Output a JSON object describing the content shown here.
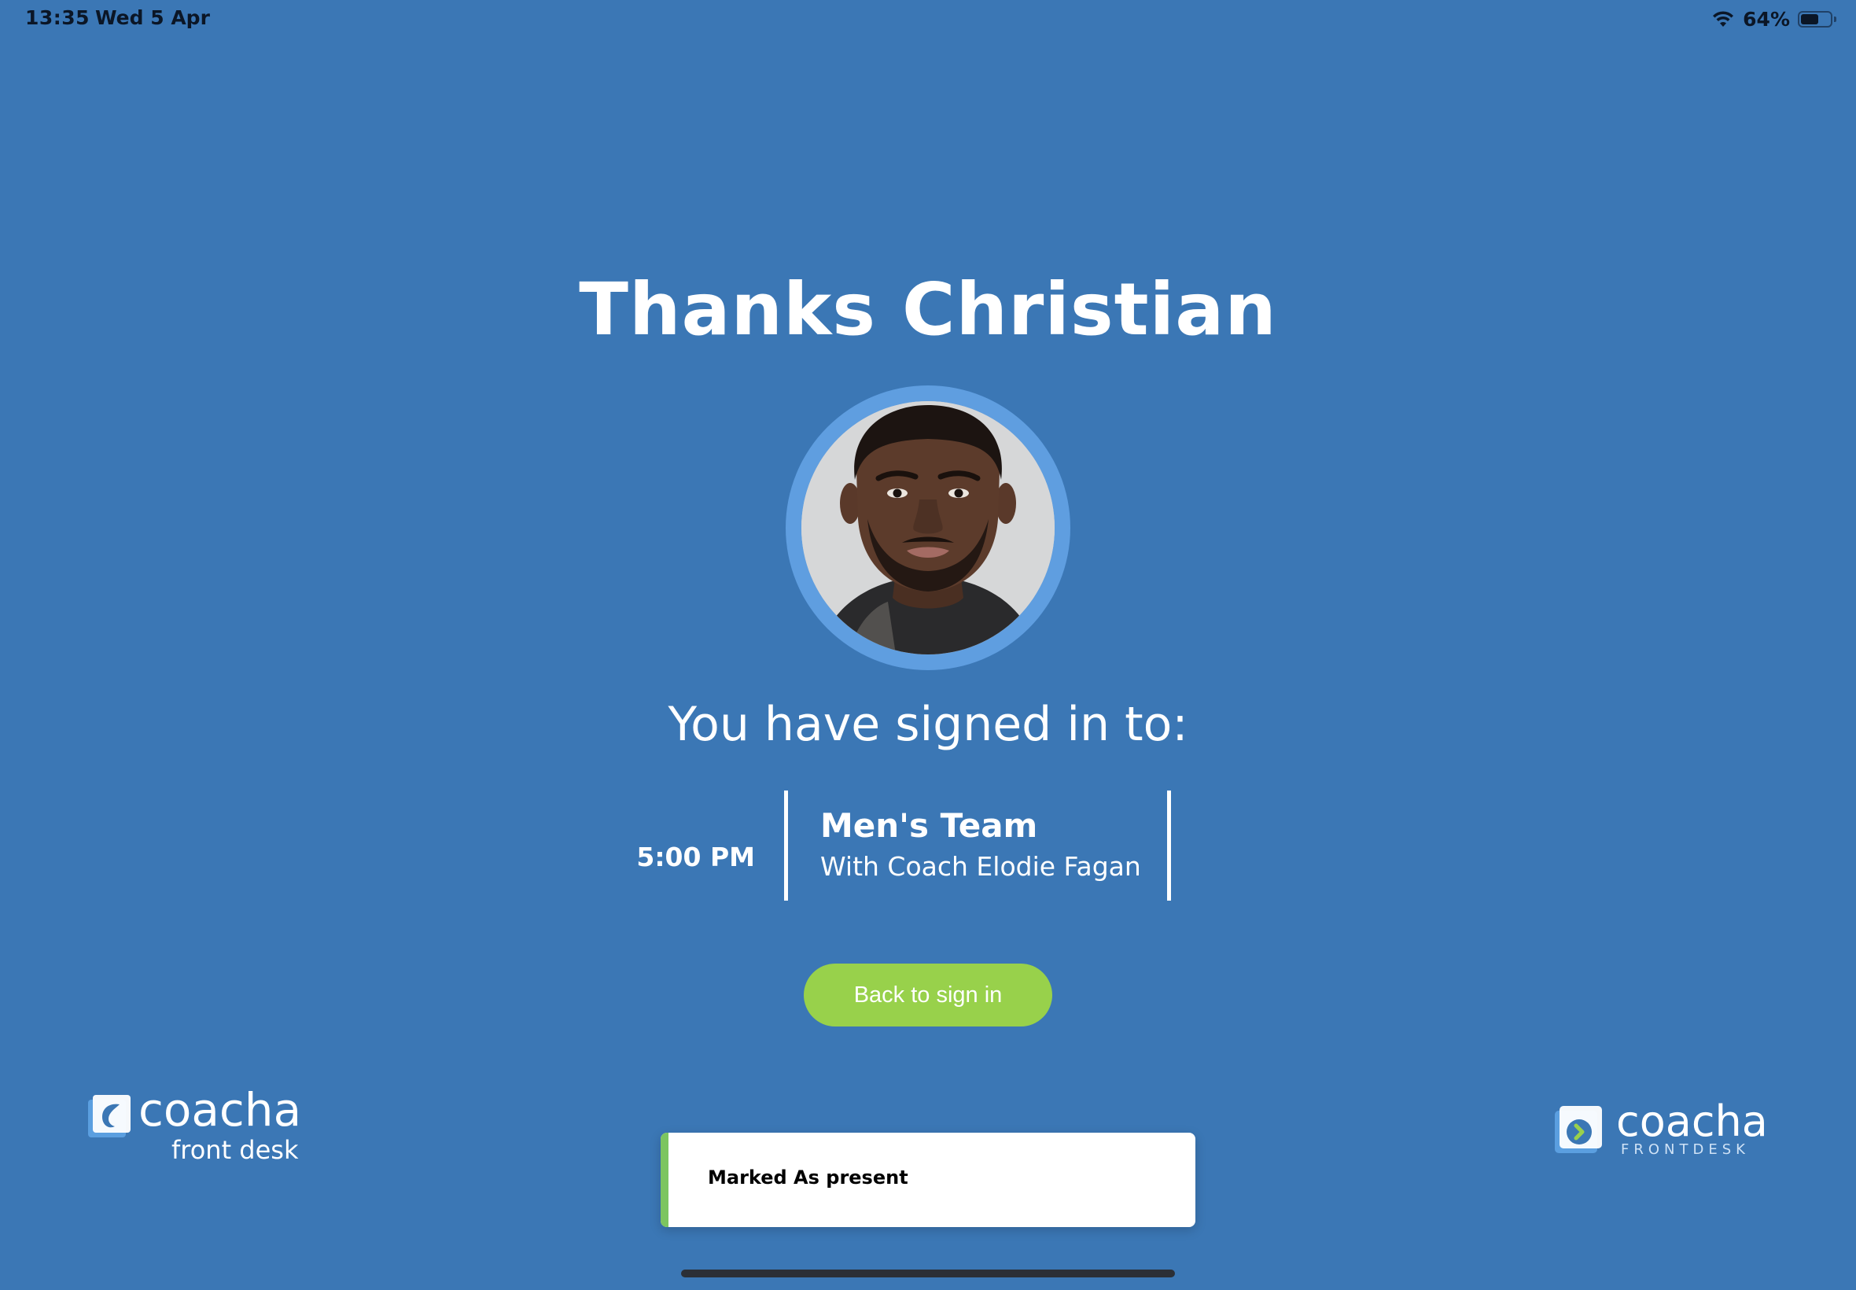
{
  "status_bar": {
    "time": "13:35",
    "date": "Wed 5 Apr",
    "battery_text": "64%",
    "battery_level": 0.64,
    "wifi_icon": "wifi-icon"
  },
  "main": {
    "title": "Thanks Christian",
    "subtitle": "You have signed in to:",
    "session": {
      "time": "5:00 PM",
      "name": "Men's Team",
      "coach": "With Coach Elodie Fagan"
    },
    "back_button_label": "Back to sign in"
  },
  "logos": {
    "left_word": "coacha",
    "left_sub": "front desk",
    "right_word": "coacha",
    "right_sub": "FRONTDESK"
  },
  "toast": {
    "message": "Marked As present"
  },
  "colors": {
    "background": "#3b77b5",
    "button": "#98d14b",
    "toast_accent": "#7cc55f",
    "avatar_ring": "#5f9ee0"
  }
}
